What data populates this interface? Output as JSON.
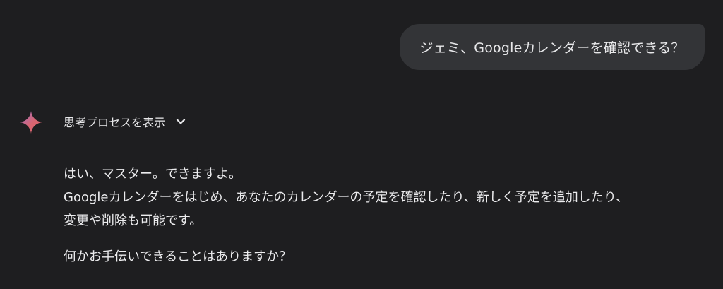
{
  "user_message": {
    "text": "ジェミ、Googleカレンダーを確認できる？"
  },
  "assistant": {
    "avatar_icon": "gemini-spark-icon",
    "thinking_toggle_label": "思考プロセスを表示",
    "chevron_icon": "chevron-down-icon",
    "paragraph1_lines": [
      "はい、マスター。できますよ。",
      "Googleカレンダーをはじめ、あなたのカレンダーの予定を確認したり、新しく予定を追加したり、",
      "変更や削除も可能です。"
    ],
    "paragraph2": "何かお手伝いできることはありますか？"
  },
  "colors": {
    "background": "#1e1e20",
    "bubble": "#333437",
    "text": "#e8e8ea"
  }
}
